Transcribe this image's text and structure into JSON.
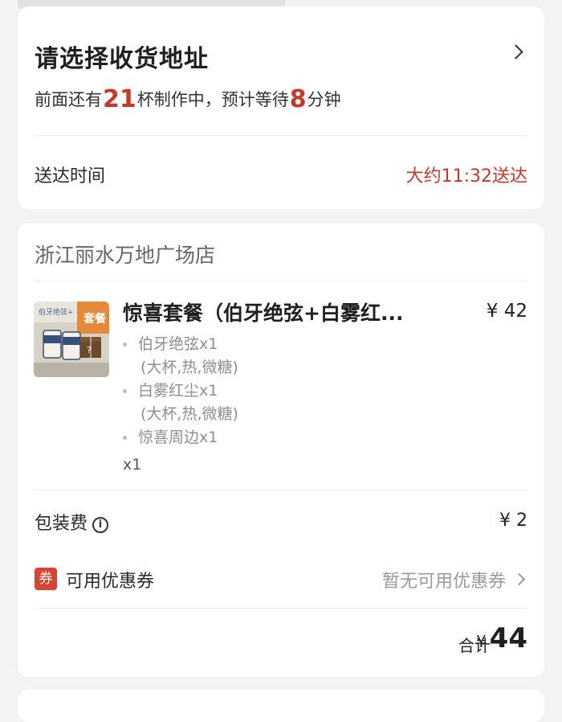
{
  "address": {
    "title": "请选择收货地址",
    "queue_prefix": "前面还有",
    "queue_count": "21",
    "queue_middle": "杯制作中，预计等待",
    "wait_minutes": "8",
    "queue_suffix": "分钟"
  },
  "delivery": {
    "label": "送达时间",
    "value": "大约11:32送达"
  },
  "order": {
    "store": "浙江丽水万地广场店",
    "product": {
      "name": "惊喜套餐（伯牙绝弦+白雾红...",
      "price": "¥ 42",
      "thumb_badge": "套餐",
      "thumb_title": "伯牙绝弦+",
      "items": [
        {
          "name": "伯牙绝弦x1",
          "spec": "(大杯,热,微糖)"
        },
        {
          "name": "白雾红尘x1",
          "spec": "(大杯,热,微糖)"
        },
        {
          "name": "惊喜周边x1",
          "spec": ""
        }
      ],
      "qty": "x1"
    },
    "packing": {
      "label": "包装费",
      "value": "¥ 2"
    },
    "coupon": {
      "badge": "券",
      "label": "可用优惠券",
      "value": "暂无可用优惠券"
    },
    "total": {
      "label": "合计",
      "currency": "¥",
      "amount": "44"
    }
  },
  "colors": {
    "accent": "#c5392a",
    "muted": "#8e8e8e",
    "bg": "#f3f3f3"
  }
}
